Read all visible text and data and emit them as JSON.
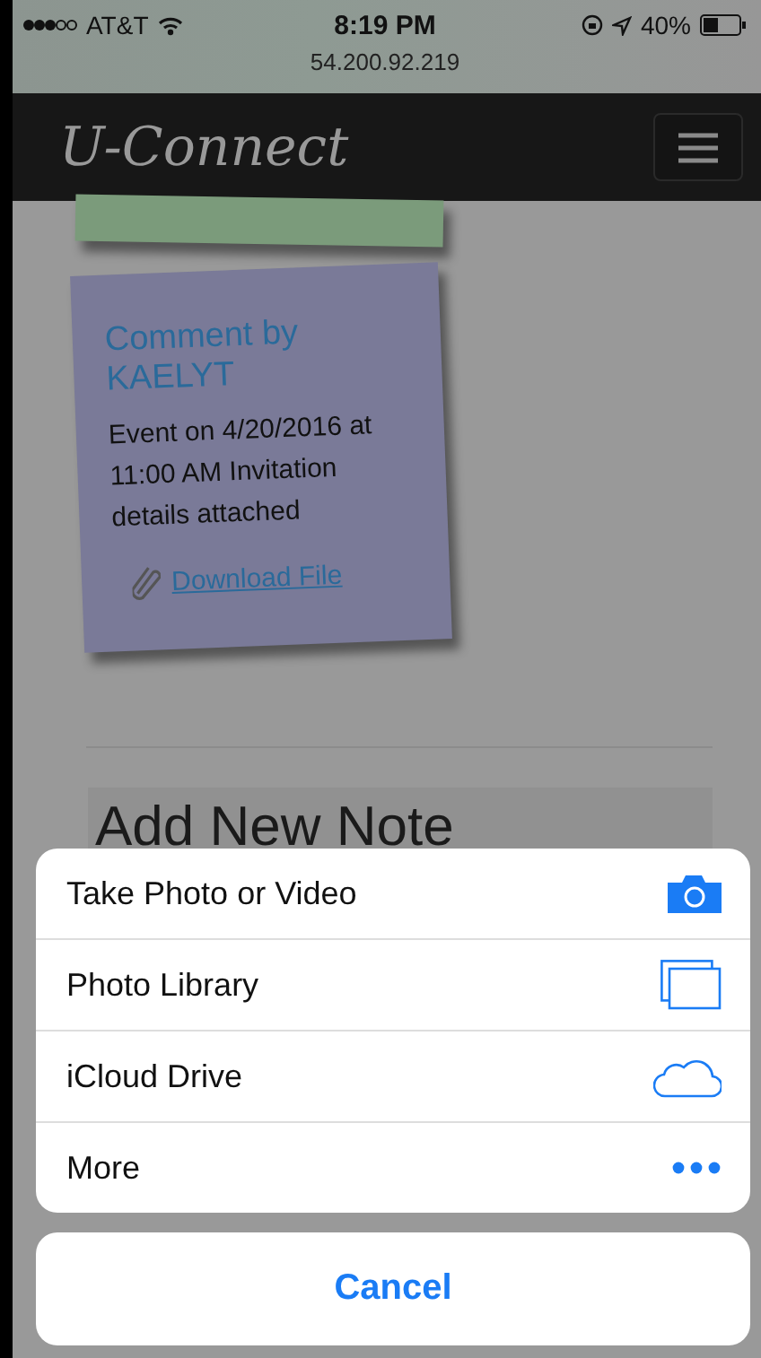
{
  "status_bar": {
    "carrier": "AT&T",
    "time": "8:19 PM",
    "url": "54.200.92.219",
    "battery": "40%"
  },
  "navbar": {
    "brand": "U-Connect"
  },
  "notes": [
    {
      "color": "#7b9b7b"
    },
    {
      "color": "#7a7a98",
      "title": "Comment by KAELYT",
      "body": "Event on 4/20/2016 at 11:00 AM Invitation details attached",
      "link": "Download File"
    }
  ],
  "section_heading": "Add New Note",
  "action_sheet": {
    "items": [
      {
        "kind": "camera",
        "label": "Take Photo or Video"
      },
      {
        "kind": "library",
        "label": "Photo Library"
      },
      {
        "kind": "cloud",
        "label": "iCloud Drive"
      },
      {
        "kind": "more",
        "label": "More"
      }
    ],
    "cancel": "Cancel"
  }
}
